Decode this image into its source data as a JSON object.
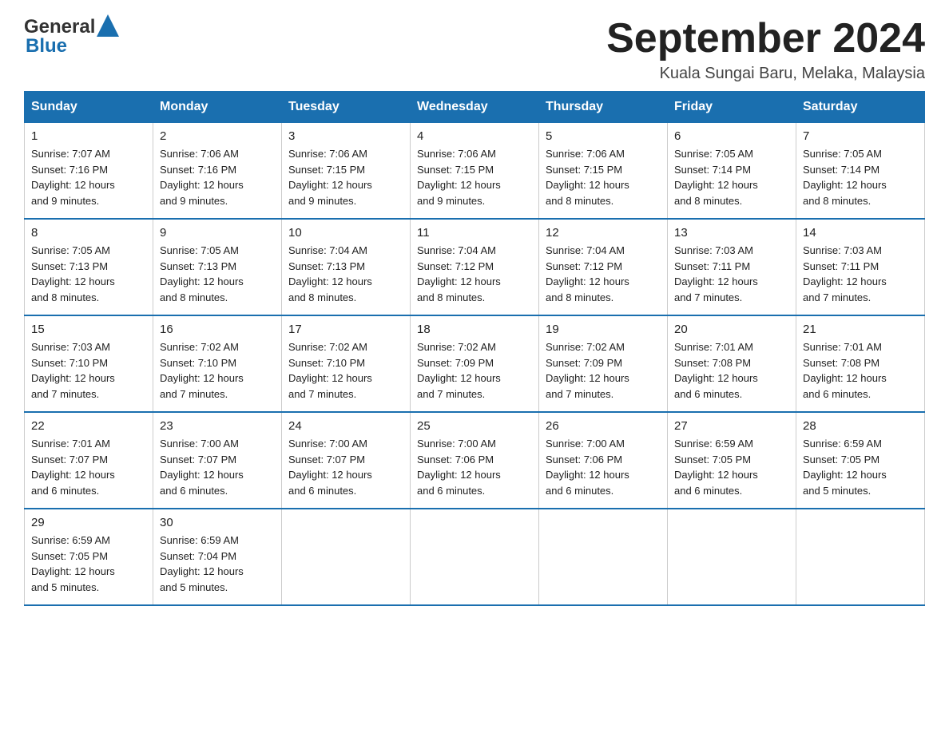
{
  "header": {
    "logo_general": "General",
    "logo_blue": "Blue",
    "title": "September 2024",
    "location": "Kuala Sungai Baru, Melaka, Malaysia"
  },
  "columns": [
    "Sunday",
    "Monday",
    "Tuesday",
    "Wednesday",
    "Thursday",
    "Friday",
    "Saturday"
  ],
  "weeks": [
    [
      {
        "day": "1",
        "sunrise": "7:07 AM",
        "sunset": "7:16 PM",
        "daylight": "12 hours and 9 minutes."
      },
      {
        "day": "2",
        "sunrise": "7:06 AM",
        "sunset": "7:16 PM",
        "daylight": "12 hours and 9 minutes."
      },
      {
        "day": "3",
        "sunrise": "7:06 AM",
        "sunset": "7:15 PM",
        "daylight": "12 hours and 9 minutes."
      },
      {
        "day": "4",
        "sunrise": "7:06 AM",
        "sunset": "7:15 PM",
        "daylight": "12 hours and 9 minutes."
      },
      {
        "day": "5",
        "sunrise": "7:06 AM",
        "sunset": "7:15 PM",
        "daylight": "12 hours and 8 minutes."
      },
      {
        "day": "6",
        "sunrise": "7:05 AM",
        "sunset": "7:14 PM",
        "daylight": "12 hours and 8 minutes."
      },
      {
        "day": "7",
        "sunrise": "7:05 AM",
        "sunset": "7:14 PM",
        "daylight": "12 hours and 8 minutes."
      }
    ],
    [
      {
        "day": "8",
        "sunrise": "7:05 AM",
        "sunset": "7:13 PM",
        "daylight": "12 hours and 8 minutes."
      },
      {
        "day": "9",
        "sunrise": "7:05 AM",
        "sunset": "7:13 PM",
        "daylight": "12 hours and 8 minutes."
      },
      {
        "day": "10",
        "sunrise": "7:04 AM",
        "sunset": "7:13 PM",
        "daylight": "12 hours and 8 minutes."
      },
      {
        "day": "11",
        "sunrise": "7:04 AM",
        "sunset": "7:12 PM",
        "daylight": "12 hours and 8 minutes."
      },
      {
        "day": "12",
        "sunrise": "7:04 AM",
        "sunset": "7:12 PM",
        "daylight": "12 hours and 8 minutes."
      },
      {
        "day": "13",
        "sunrise": "7:03 AM",
        "sunset": "7:11 PM",
        "daylight": "12 hours and 7 minutes."
      },
      {
        "day": "14",
        "sunrise": "7:03 AM",
        "sunset": "7:11 PM",
        "daylight": "12 hours and 7 minutes."
      }
    ],
    [
      {
        "day": "15",
        "sunrise": "7:03 AM",
        "sunset": "7:10 PM",
        "daylight": "12 hours and 7 minutes."
      },
      {
        "day": "16",
        "sunrise": "7:02 AM",
        "sunset": "7:10 PM",
        "daylight": "12 hours and 7 minutes."
      },
      {
        "day": "17",
        "sunrise": "7:02 AM",
        "sunset": "7:10 PM",
        "daylight": "12 hours and 7 minutes."
      },
      {
        "day": "18",
        "sunrise": "7:02 AM",
        "sunset": "7:09 PM",
        "daylight": "12 hours and 7 minutes."
      },
      {
        "day": "19",
        "sunrise": "7:02 AM",
        "sunset": "7:09 PM",
        "daylight": "12 hours and 7 minutes."
      },
      {
        "day": "20",
        "sunrise": "7:01 AM",
        "sunset": "7:08 PM",
        "daylight": "12 hours and 6 minutes."
      },
      {
        "day": "21",
        "sunrise": "7:01 AM",
        "sunset": "7:08 PM",
        "daylight": "12 hours and 6 minutes."
      }
    ],
    [
      {
        "day": "22",
        "sunrise": "7:01 AM",
        "sunset": "7:07 PM",
        "daylight": "12 hours and 6 minutes."
      },
      {
        "day": "23",
        "sunrise": "7:00 AM",
        "sunset": "7:07 PM",
        "daylight": "12 hours and 6 minutes."
      },
      {
        "day": "24",
        "sunrise": "7:00 AM",
        "sunset": "7:07 PM",
        "daylight": "12 hours and 6 minutes."
      },
      {
        "day": "25",
        "sunrise": "7:00 AM",
        "sunset": "7:06 PM",
        "daylight": "12 hours and 6 minutes."
      },
      {
        "day": "26",
        "sunrise": "7:00 AM",
        "sunset": "7:06 PM",
        "daylight": "12 hours and 6 minutes."
      },
      {
        "day": "27",
        "sunrise": "6:59 AM",
        "sunset": "7:05 PM",
        "daylight": "12 hours and 6 minutes."
      },
      {
        "day": "28",
        "sunrise": "6:59 AM",
        "sunset": "7:05 PM",
        "daylight": "12 hours and 5 minutes."
      }
    ],
    [
      {
        "day": "29",
        "sunrise": "6:59 AM",
        "sunset": "7:05 PM",
        "daylight": "12 hours and 5 minutes."
      },
      {
        "day": "30",
        "sunrise": "6:59 AM",
        "sunset": "7:04 PM",
        "daylight": "12 hours and 5 minutes."
      },
      null,
      null,
      null,
      null,
      null
    ]
  ]
}
